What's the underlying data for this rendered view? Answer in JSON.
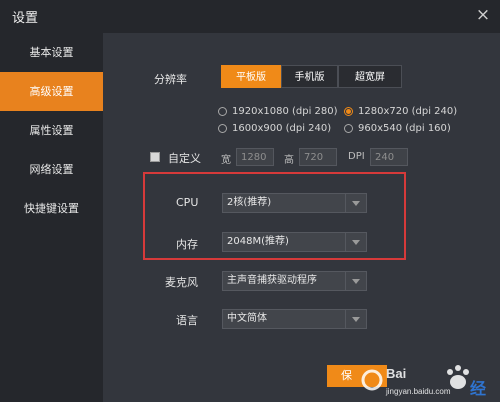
{
  "window": {
    "title": "设置",
    "close_glyph": "×"
  },
  "sidebar": {
    "items": [
      {
        "label": "基本设置",
        "active": false
      },
      {
        "label": "高级设置",
        "active": true
      },
      {
        "label": "属性设置",
        "active": false
      },
      {
        "label": "网络设置",
        "active": false
      },
      {
        "label": "快捷键设置",
        "active": false
      }
    ]
  },
  "resolution": {
    "label": "分辨率",
    "modes": [
      {
        "label": "平板版",
        "active": true
      },
      {
        "label": "手机版",
        "active": false
      },
      {
        "label": "超宽屏",
        "active": false
      }
    ],
    "options": [
      {
        "label": "1920x1080 (dpi 280)",
        "selected": false
      },
      {
        "label": "1280x720 (dpi 240)",
        "selected": true
      },
      {
        "label": "1600x900 (dpi 240)",
        "selected": false
      },
      {
        "label": "960x540 (dpi 160)",
        "selected": false
      }
    ]
  },
  "custom": {
    "label": "自定义",
    "width_label": "宽",
    "width_value": "1280",
    "height_label": "高",
    "height_value": "720",
    "dpi_label": "DPI",
    "dpi_value": "240"
  },
  "cpu": {
    "label": "CPU",
    "value": "2核(推荐)"
  },
  "memory": {
    "label": "内存",
    "value": "2048M(推荐)"
  },
  "microphone": {
    "label": "麦克风",
    "value": "主声音捕获驱动程序"
  },
  "language": {
    "label": "语言",
    "value": "中文简体"
  },
  "footer": {
    "save_label": "保",
    "watermark_text": "Bai",
    "watermark_site": "jingyan.baidu.com"
  },
  "colors": {
    "accent": "#f08a18",
    "highlight_border": "#d63a3a",
    "sidebar_bg": "#25272c",
    "content_bg": "#33363d"
  }
}
